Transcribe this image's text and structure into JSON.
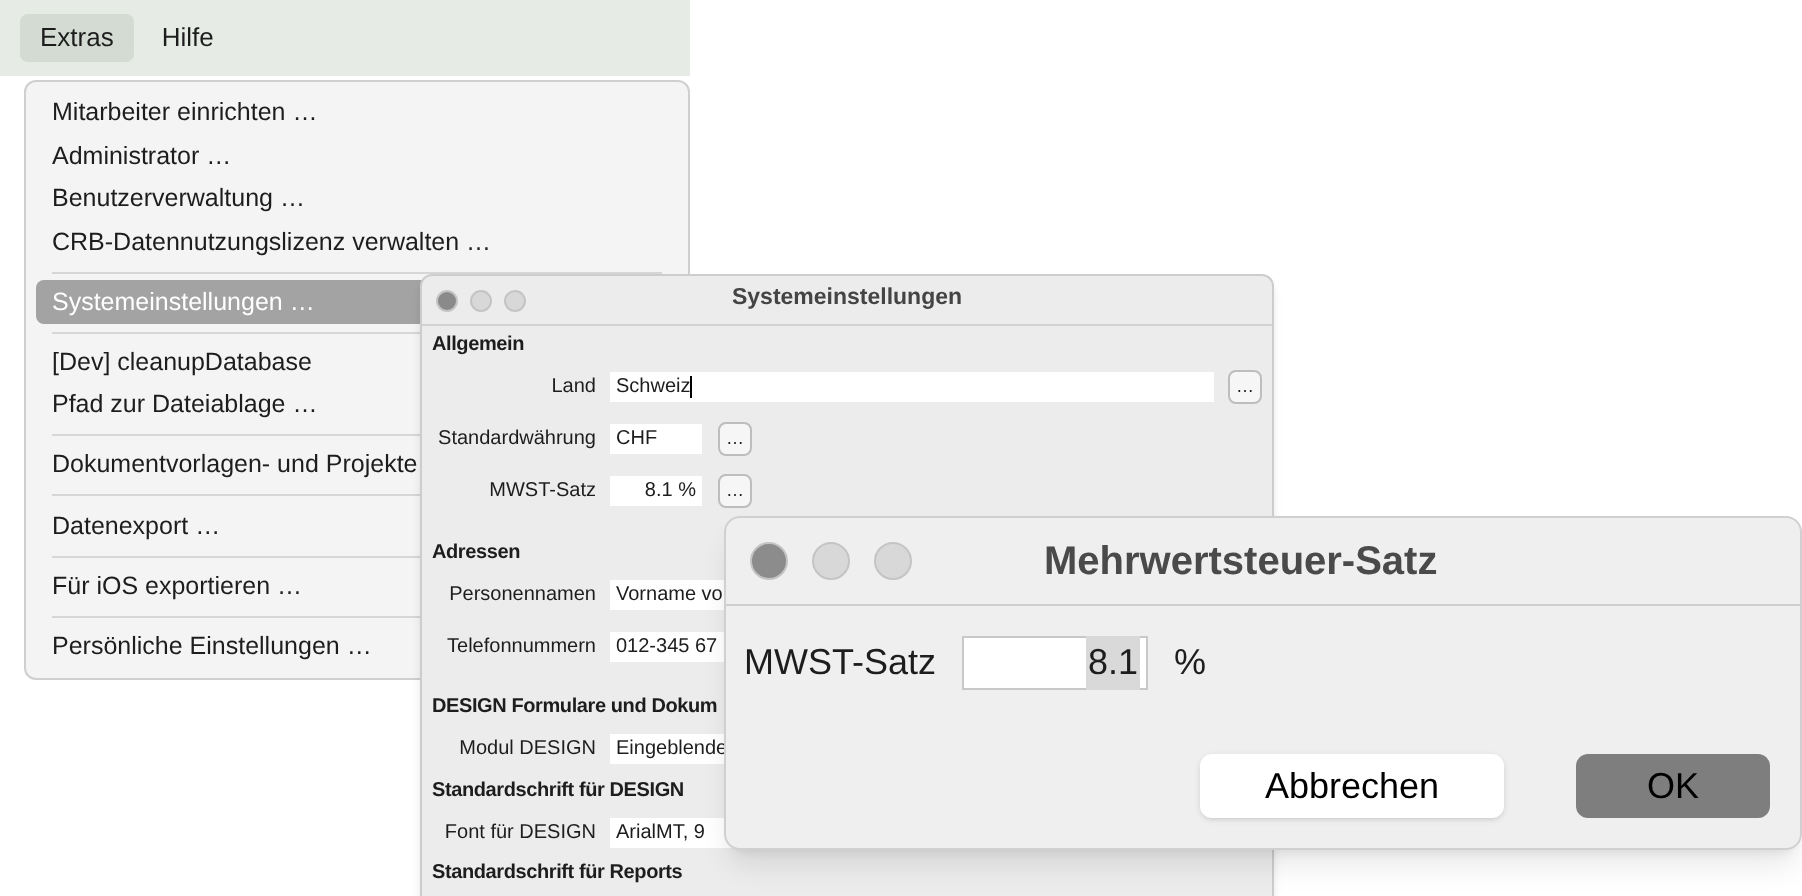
{
  "menu_bar": [
    {
      "label": "Extras",
      "selected": true
    },
    {
      "label": "Hilfe",
      "selected": false
    }
  ],
  "menu": {
    "items": [
      {
        "kind": "item",
        "label": "Mitarbeiter einrichten …",
        "selected": false
      },
      {
        "kind": "item",
        "label": "Administrator …",
        "selected": false
      },
      {
        "kind": "item",
        "label": "Benutzerverwaltung …",
        "selected": false
      },
      {
        "kind": "item",
        "label": "CRB-Datennutzungslizenz verwalten …",
        "selected": false
      },
      {
        "kind": "separator"
      },
      {
        "kind": "item",
        "label": "Systemeinstellungen …",
        "selected": true
      },
      {
        "kind": "separator"
      },
      {
        "kind": "item",
        "label": "[Dev] cleanupDatabase",
        "selected": false
      },
      {
        "kind": "item",
        "label": "Pfad zur Dateiablage …",
        "selected": false
      },
      {
        "kind": "separator"
      },
      {
        "kind": "item",
        "label": "Dokumentvorlagen- und Projekte",
        "selected": false
      },
      {
        "kind": "separator"
      },
      {
        "kind": "item",
        "label": "Datenexport …",
        "selected": false
      },
      {
        "kind": "separator"
      },
      {
        "kind": "item",
        "label": "Für iOS exportieren …",
        "selected": false
      },
      {
        "kind": "separator"
      },
      {
        "kind": "item",
        "label": "Persönliche Einstellungen …",
        "selected": false
      }
    ]
  },
  "settings_window": {
    "title": "Systemeinstellungen",
    "sections": [
      {
        "heading": "Allgemein",
        "rows": [
          {
            "label": "Land",
            "value": "Schweiz",
            "kind": "wide",
            "focused": true,
            "button": "…"
          },
          {
            "label": "Standardwährung",
            "value": "CHF",
            "kind": "short",
            "button": "…"
          },
          {
            "label": "MWST-Satz",
            "value": "8.1 %",
            "kind": "number",
            "button": "…"
          }
        ]
      },
      {
        "heading": "Adressen",
        "rows": [
          {
            "label": "Personennamen",
            "value": "Vorname vo",
            "kind": "clipped"
          },
          {
            "label": "Telefonnummern",
            "value": "012-345 67",
            "kind": "clipped"
          }
        ]
      },
      {
        "heading": "DESIGN Formulare und Dokum",
        "rows": [
          {
            "label": "Modul DESIGN",
            "value": "Eingeblende",
            "kind": "clipped"
          }
        ]
      },
      {
        "heading": "Standardschrift für DESIGN",
        "rows": [
          {
            "label": "Font für DESIGN",
            "value": "ArialMT, 9",
            "kind": "clipped"
          }
        ]
      },
      {
        "heading": "Standardschrift für Reports"
      }
    ]
  },
  "dialog": {
    "title": "Mehrwertsteuer-Satz",
    "label": "MWST-Satz",
    "value": "8.1",
    "value_selected": true,
    "unit": "%",
    "buttons": [
      {
        "label": "Abbrechen",
        "kind": "cancel"
      },
      {
        "label": "OK",
        "kind": "default"
      }
    ]
  }
}
